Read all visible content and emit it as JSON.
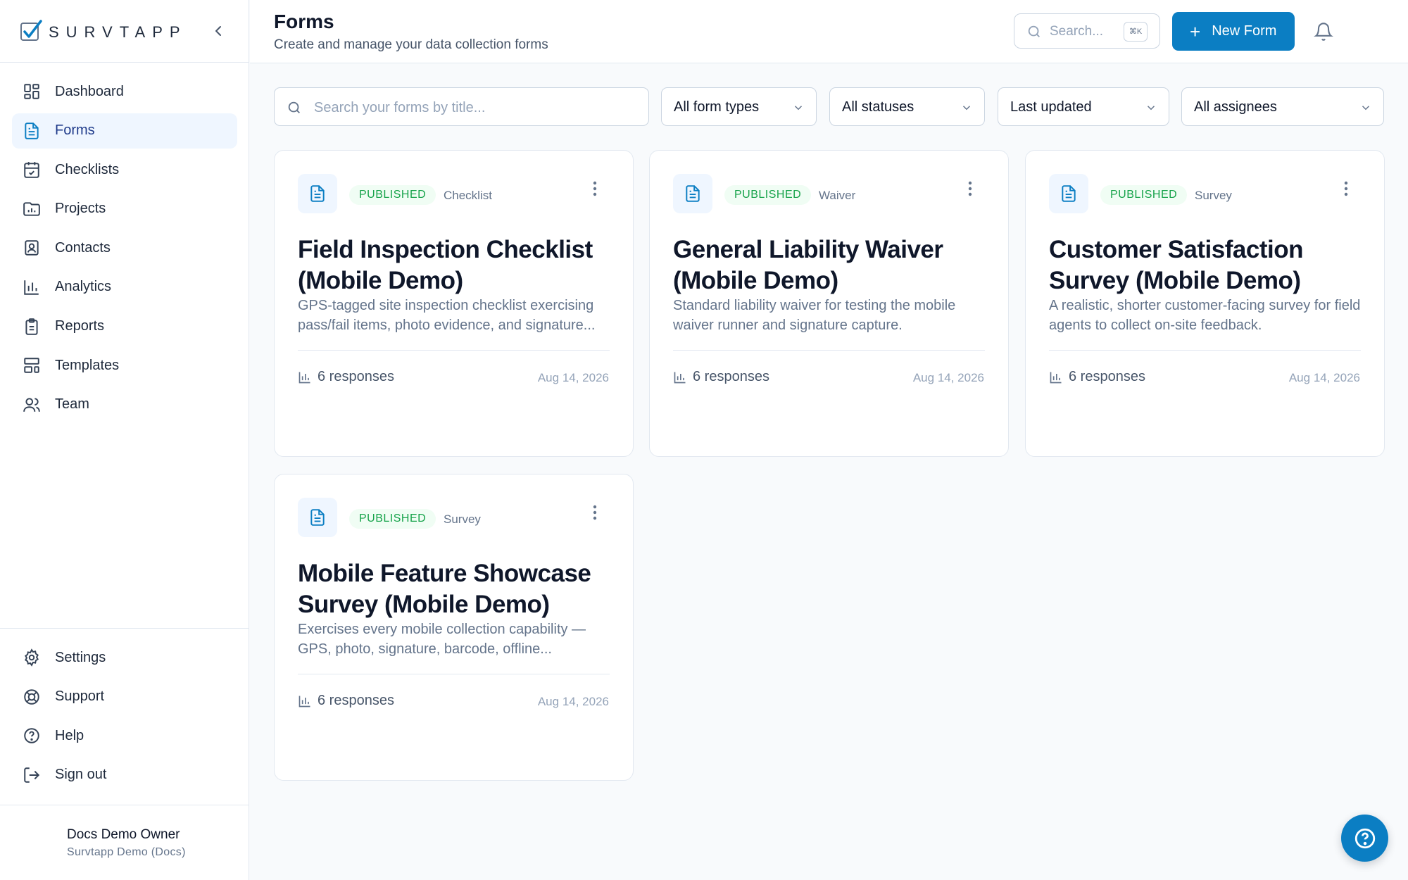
{
  "brand": {
    "name": "SURVTAPP"
  },
  "sidebar": {
    "items": [
      {
        "label": "Dashboard",
        "icon": "dashboard-icon"
      },
      {
        "label": "Forms",
        "icon": "form-icon",
        "active": true
      },
      {
        "label": "Checklists",
        "icon": "calendar-check-icon"
      },
      {
        "label": "Projects",
        "icon": "folder-chart-icon"
      },
      {
        "label": "Contacts",
        "icon": "contact-card-icon"
      },
      {
        "label": "Analytics",
        "icon": "bar-chart-icon"
      },
      {
        "label": "Reports",
        "icon": "clipboard-icon"
      },
      {
        "label": "Templates",
        "icon": "layout-template-icon"
      },
      {
        "label": "Team",
        "icon": "users-icon"
      }
    ],
    "bottom_items": [
      {
        "label": "Settings",
        "icon": "gear-icon"
      },
      {
        "label": "Support",
        "icon": "life-buoy-icon"
      },
      {
        "label": "Help",
        "icon": "help-circle-icon"
      },
      {
        "label": "Sign out",
        "icon": "sign-out-icon"
      }
    ],
    "user": {
      "name": "Docs Demo Owner",
      "org": "Survtapp Demo (Docs)"
    }
  },
  "header": {
    "title": "Forms",
    "subtitle": "Create and manage your data collection forms",
    "search_placeholder": "Search...",
    "shortcut": "⌘K",
    "new_form_label": "New Form"
  },
  "filters": {
    "search_placeholder": "Search your forms by title...",
    "form_type": "All form types",
    "status": "All statuses",
    "sort": "Last updated",
    "assignee": "All assignees"
  },
  "forms": [
    {
      "status": "PUBLISHED",
      "type": "Checklist",
      "title": "Field Inspection Checklist (Mobile Demo)",
      "description": "GPS-tagged site inspection checklist exercising pass/fail items, photo evidence, and signature...",
      "responses": "6 responses",
      "updated": "Aug 14, 2026"
    },
    {
      "status": "PUBLISHED",
      "type": "Waiver",
      "title": "General Liability Waiver (Mobile Demo)",
      "description": "Standard liability waiver for testing the mobile waiver runner and signature capture.",
      "responses": "6 responses",
      "updated": "Aug 14, 2026"
    },
    {
      "status": "PUBLISHED",
      "type": "Survey",
      "title": "Customer Satisfaction Survey (Mobile Demo)",
      "description": "A realistic, shorter customer-facing survey for field agents to collect on-site feedback.",
      "responses": "6 responses",
      "updated": "Aug 14, 2026"
    },
    {
      "status": "PUBLISHED",
      "type": "Survey",
      "title": "Mobile Feature Showcase Survey (Mobile Demo)",
      "description": "Exercises every mobile collection capability — GPS, photo, signature, barcode, offline...",
      "responses": "6 responses",
      "updated": "Aug 14, 2026"
    }
  ],
  "colors": {
    "accent": "#0b7ec3",
    "published_text": "#16a34a",
    "published_bg": "#f0fdf4",
    "active_nav_bg": "#eff6ff"
  }
}
